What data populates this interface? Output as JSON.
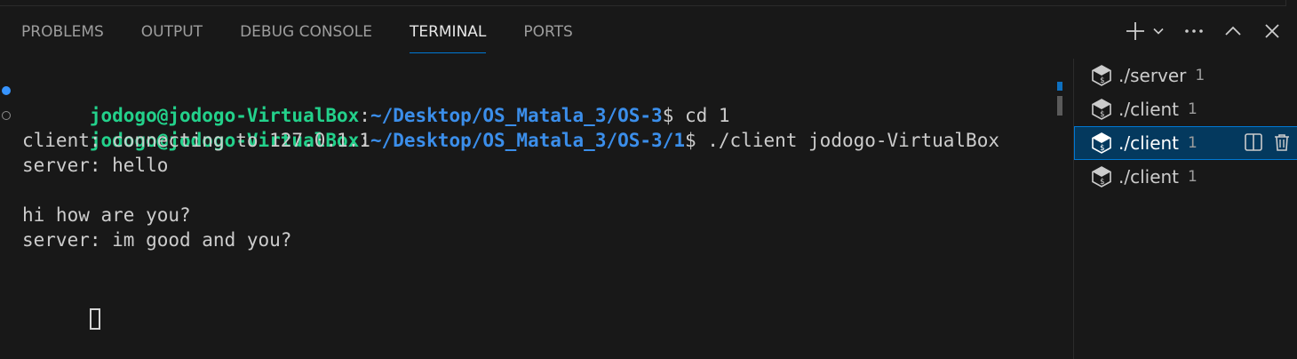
{
  "tabs": [
    {
      "label": "PROBLEMS"
    },
    {
      "label": "OUTPUT"
    },
    {
      "label": "DEBUG CONSOLE"
    },
    {
      "label": "TERMINAL"
    },
    {
      "label": "PORTS"
    }
  ],
  "active_tab": "TERMINAL",
  "actions": {
    "new_terminal_icon": "plus-icon",
    "dropdown_icon": "chevron-down-icon",
    "more_icon": "ellipsis-icon",
    "maximize_icon": "chevron-up-icon",
    "close_icon": "close-icon"
  },
  "terminal": {
    "lines": [
      {
        "user": "jodogo@jodogo-VirtualBox",
        "sep": ":",
        "path": "~/Desktop/OS_Matala_3/OS-3",
        "cmd": "$ cd 1"
      },
      {
        "user": "jodogo@jodogo-VirtualBox",
        "sep": ":",
        "path": "~/Desktop/OS_Matala_3/OS-3/1",
        "cmd": "$ ./client jodogo-VirtualBox"
      }
    ],
    "output": [
      "client: connecting to 127.0.1.1",
      "server: hello",
      "",
      "hi how are you?",
      "server: im good and you?",
      ""
    ]
  },
  "sidebar": {
    "items": [
      {
        "label": "./server",
        "count": "1"
      },
      {
        "label": "./client",
        "count": "1"
      },
      {
        "label": "./client",
        "count": "1"
      },
      {
        "label": "./client",
        "count": "1"
      }
    ],
    "selected_index": 2,
    "item_icon": "terminal-bash-icon",
    "split_icon": "split-terminal-icon",
    "trash_icon": "trash-icon"
  },
  "colors": {
    "background": "#181818",
    "prompt_user": "#23d18b",
    "prompt_path": "#3b8eea",
    "accent": "#0078d4"
  }
}
